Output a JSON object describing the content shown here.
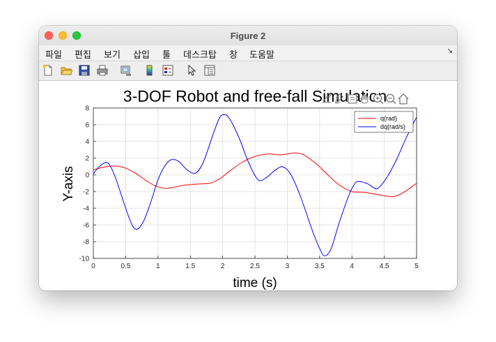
{
  "window": {
    "title": "Figure 2"
  },
  "menu": [
    "파일",
    "편집",
    "보기",
    "삽입",
    "툴",
    "데스크탑",
    "창",
    "도움말"
  ],
  "menu_overflow_icon": "corner-arrow-icon",
  "toolbar": {
    "buttons": [
      {
        "name": "new-figure-icon"
      },
      {
        "name": "open-file-icon"
      },
      {
        "name": "save-icon"
      },
      {
        "name": "print-icon"
      },
      {
        "name": "link-plot-icon"
      },
      {
        "name": "insert-colorbar-icon"
      },
      {
        "name": "insert-legend-icon"
      },
      {
        "name": "edit-plot-pointer-icon"
      },
      {
        "name": "property-inspector-icon"
      }
    ]
  },
  "axes_toolbar": [
    "export-icon",
    "brush-icon",
    "datatip-icon",
    "pan-hand-icon",
    "zoom-in-icon",
    "zoom-out-icon",
    "home-icon"
  ],
  "chart_data": {
    "type": "line",
    "title": "3-DOF Robot and free-fall Simulation",
    "xlabel": "time (s)",
    "ylabel": "Y-axis",
    "xlim": [
      0,
      5
    ],
    "ylim": [
      -10,
      8
    ],
    "xticks": [
      "0",
      "0.5",
      "1",
      "1.5",
      "2",
      "2.5",
      "3",
      "3.5",
      "4",
      "4.5",
      "5"
    ],
    "yticks": [
      "-10",
      "-8",
      "-6",
      "-4",
      "-2",
      "0",
      "2",
      "4",
      "6",
      "8"
    ],
    "grid": true,
    "legend_position": "top-right",
    "series": [
      {
        "name": "q(rad)",
        "color": "#ff0000",
        "points": [
          [
            0,
            0.6
          ],
          [
            0.15,
            0.9
          ],
          [
            0.3,
            1.05
          ],
          [
            0.4,
            1.0
          ],
          [
            0.5,
            0.8
          ],
          [
            0.65,
            0.2
          ],
          [
            0.8,
            -0.6
          ],
          [
            0.95,
            -1.3
          ],
          [
            1.1,
            -1.6
          ],
          [
            1.2,
            -1.55
          ],
          [
            1.4,
            -1.25
          ],
          [
            1.6,
            -1.1
          ],
          [
            1.8,
            -1.0
          ],
          [
            1.95,
            -0.5
          ],
          [
            2.1,
            0.4
          ],
          [
            2.3,
            1.5
          ],
          [
            2.5,
            2.2
          ],
          [
            2.7,
            2.5
          ],
          [
            2.9,
            2.4
          ],
          [
            3.1,
            2.6
          ],
          [
            3.25,
            2.4
          ],
          [
            3.45,
            1.3
          ],
          [
            3.6,
            0.2
          ],
          [
            3.8,
            -1.2
          ],
          [
            4.0,
            -2.0
          ],
          [
            4.2,
            -2.1
          ],
          [
            4.5,
            -2.5
          ],
          [
            4.65,
            -2.6
          ],
          [
            4.8,
            -2.1
          ],
          [
            5.0,
            -1.0
          ]
        ]
      },
      {
        "name": "dq(rad/s)",
        "color": "#0000ff",
        "points": [
          [
            0,
            0.1
          ],
          [
            0.08,
            0.9
          ],
          [
            0.18,
            1.45
          ],
          [
            0.25,
            1.2
          ],
          [
            0.35,
            -0.5
          ],
          [
            0.5,
            -4.0
          ],
          [
            0.6,
            -6.0
          ],
          [
            0.68,
            -6.5
          ],
          [
            0.78,
            -5.5
          ],
          [
            0.9,
            -3.0
          ],
          [
            1.0,
            -0.6
          ],
          [
            1.1,
            1.0
          ],
          [
            1.2,
            1.8
          ],
          [
            1.32,
            1.6
          ],
          [
            1.45,
            0.6
          ],
          [
            1.58,
            0.2
          ],
          [
            1.7,
            1.5
          ],
          [
            1.85,
            4.8
          ],
          [
            1.95,
            6.8
          ],
          [
            2.02,
            7.2
          ],
          [
            2.1,
            6.8
          ],
          [
            2.25,
            4.5
          ],
          [
            2.4,
            1.5
          ],
          [
            2.55,
            -0.6
          ],
          [
            2.68,
            -0.3
          ],
          [
            2.82,
            0.6
          ],
          [
            2.93,
            0.95
          ],
          [
            3.05,
            0.1
          ],
          [
            3.2,
            -2.5
          ],
          [
            3.38,
            -6.5
          ],
          [
            3.5,
            -8.8
          ],
          [
            3.58,
            -9.7
          ],
          [
            3.68,
            -8.8
          ],
          [
            3.8,
            -5.8
          ],
          [
            3.95,
            -2.5
          ],
          [
            4.05,
            -1.0
          ],
          [
            4.12,
            -0.8
          ],
          [
            4.25,
            -1.1
          ],
          [
            4.35,
            -1.6
          ],
          [
            4.42,
            -1.5
          ],
          [
            4.55,
            -0.2
          ],
          [
            4.7,
            2.0
          ],
          [
            4.85,
            4.6
          ],
          [
            5.0,
            6.9
          ]
        ]
      }
    ]
  }
}
